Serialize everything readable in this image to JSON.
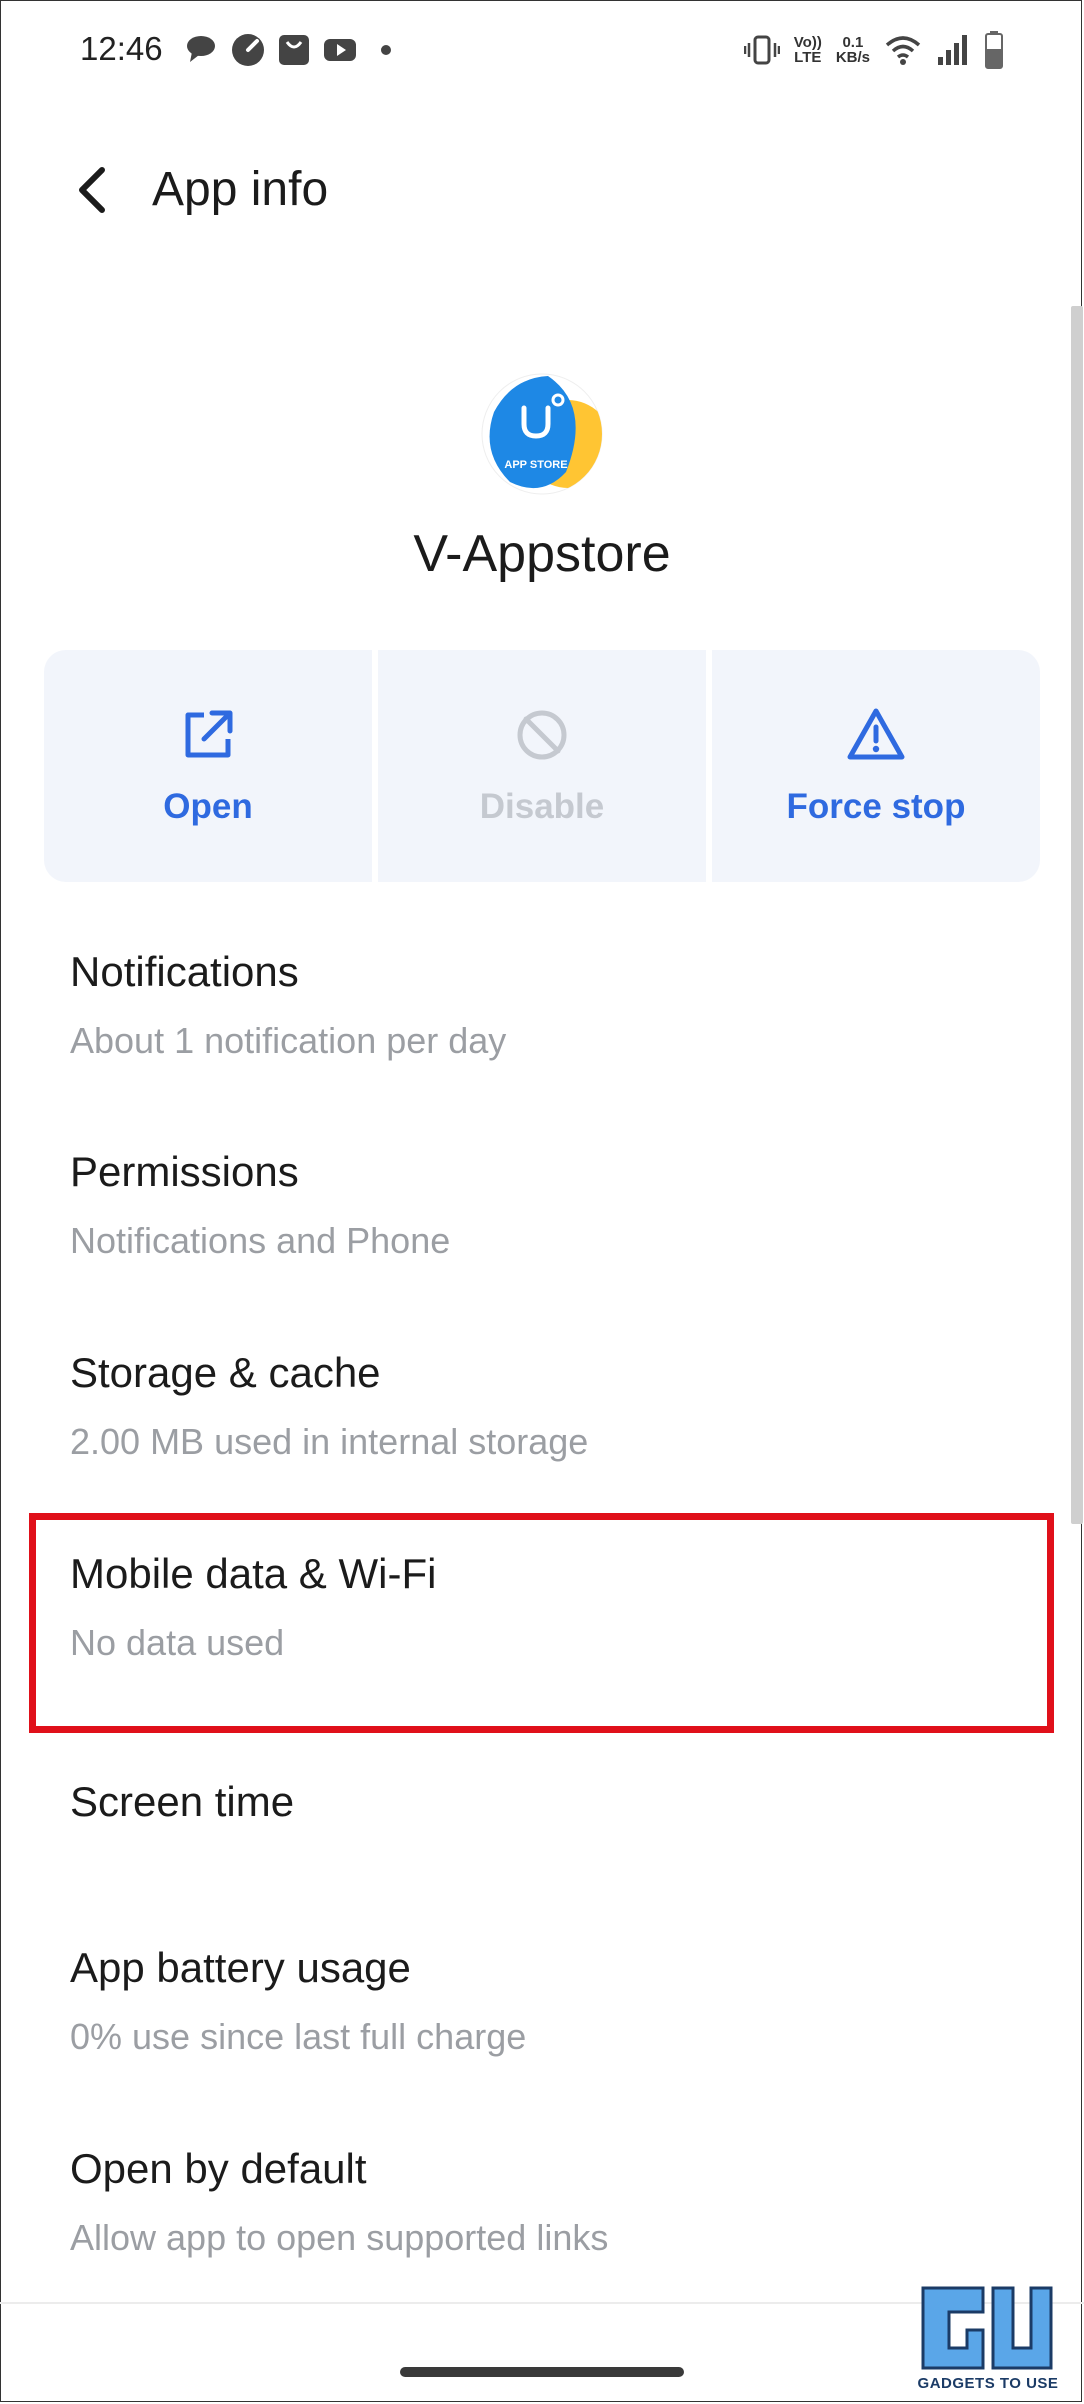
{
  "status_bar": {
    "time": "12:46",
    "notification_icons": [
      "chat-bubble-icon",
      "speedometer-icon",
      "shopping-bag-icon",
      "youtube-icon",
      "more-dot-icon"
    ],
    "volte_top": "Vo))",
    "volte_bottom": "LTE",
    "speed_value": "0.1",
    "speed_unit": "KB/s",
    "system_icons": [
      "vibrate-icon",
      "volte-icon",
      "wifi-icon",
      "signal-icon",
      "battery-icon"
    ]
  },
  "header": {
    "back_icon": "back-arrow-icon",
    "title": "App info"
  },
  "app": {
    "icon_label": "APP STORE",
    "name": "V-Appstore"
  },
  "actions": [
    {
      "label": "Open",
      "icon": "open-external-icon",
      "enabled": true
    },
    {
      "label": "Disable",
      "icon": "disable-icon",
      "enabled": false
    },
    {
      "label": "Force stop",
      "icon": "warning-icon",
      "enabled": true
    }
  ],
  "settings": [
    {
      "title": "Notifications",
      "subtitle": "About 1 notification per day"
    },
    {
      "title": "Permissions",
      "subtitle": "Notifications and Phone"
    },
    {
      "title": "Storage & cache",
      "subtitle": "2.00 MB used in internal storage"
    },
    {
      "title": "Mobile data & Wi-Fi",
      "subtitle": "No data used",
      "highlighted": true
    },
    {
      "title": "Screen time",
      "subtitle": ""
    },
    {
      "title": "App battery usage",
      "subtitle": "0% use since last full charge"
    },
    {
      "title": "Open by default",
      "subtitle": "Allow app to open supported links"
    }
  ],
  "watermark": {
    "text": "GADGETS TO USE"
  },
  "colors": {
    "accent": "#2f6ae0",
    "disabled": "#c5c9d0",
    "highlight_border": "#e0101a",
    "button_bg": "#f2f5fb",
    "subtitle": "#9b9ea3"
  }
}
